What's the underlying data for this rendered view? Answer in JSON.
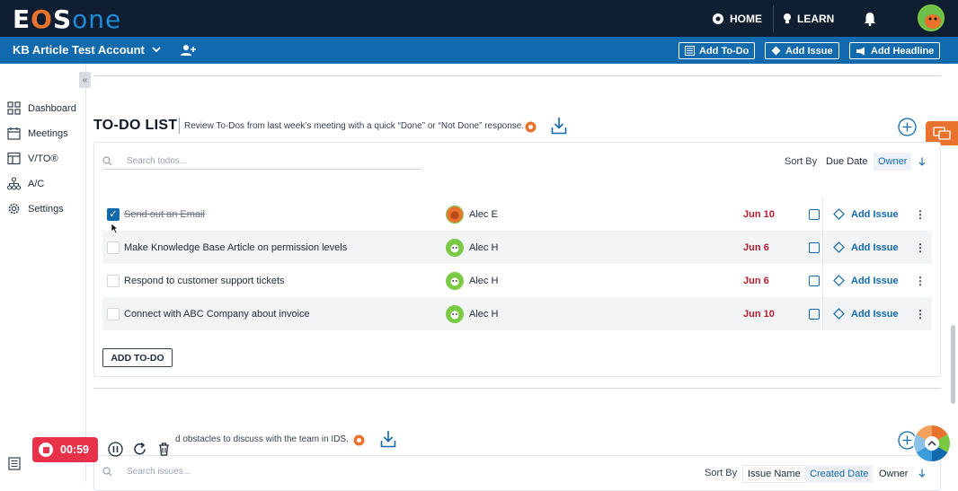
{
  "topbar": {
    "logo_part1": "E",
    "logo_part2": "O",
    "logo_part3": "S",
    "logo_part4": "one",
    "home_label": "HOME",
    "learn_label": "LEARN"
  },
  "subbar": {
    "account_name": "KB Article Test Account",
    "add_todo_label": "Add To-Do",
    "add_issue_label": "Add Issue",
    "add_headline_label": "Add Headline"
  },
  "sidebar": {
    "items": [
      {
        "label": "Dashboard",
        "icon": "grid-icon"
      },
      {
        "label": "Meetings",
        "icon": "calendar-icon"
      },
      {
        "label": "V/TO®",
        "icon": "layout-icon"
      },
      {
        "label": "A/C",
        "icon": "org-chart-icon"
      },
      {
        "label": "Settings",
        "icon": "gear-icon"
      }
    ]
  },
  "todo_section": {
    "title": "TO-DO LIST",
    "description": "Review To-Dos from last week’s meeting with a quick “Done” or “Not Done” response.",
    "search_placeholder": "Search todos...",
    "sort_by_label": "Sort By",
    "sort_options": [
      "Due Date",
      "Owner"
    ],
    "active_sort": "Owner",
    "add_todo_button": "ADD TO-DO",
    "rows": [
      {
        "text": "Send out an Email",
        "done": true,
        "owner": "Alec E",
        "due": "Jun 10",
        "action": "Add Issue"
      },
      {
        "text": "Make Knowledge Base Article on permission levels",
        "done": false,
        "owner": "Alec H",
        "due": "Jun 6",
        "action": "Add Issue"
      },
      {
        "text": "Respond to customer support tickets",
        "done": false,
        "owner": "Alec H",
        "due": "Jun 6",
        "action": "Add Issue"
      },
      {
        "text": "Connect with ABC Company about invoice",
        "done": false,
        "owner": "Alec H",
        "due": "Jun 10",
        "action": "Add Issue"
      }
    ]
  },
  "issues_section": {
    "description": "d obstacles to discuss with the team in IDS.",
    "search_placeholder": "Search issues...",
    "sort_by_label": "Sort By",
    "sort_options": [
      "Issue Name",
      "Created Date",
      "Owner"
    ],
    "active_sort": "Created Date"
  },
  "recorder": {
    "time": "00:59"
  },
  "colors": {
    "topbar": "#0f1e31",
    "subbar": "#1169ae",
    "accent_orange": "#e9732d",
    "due_red": "#b01c2e",
    "record_red": "#e8324a"
  }
}
